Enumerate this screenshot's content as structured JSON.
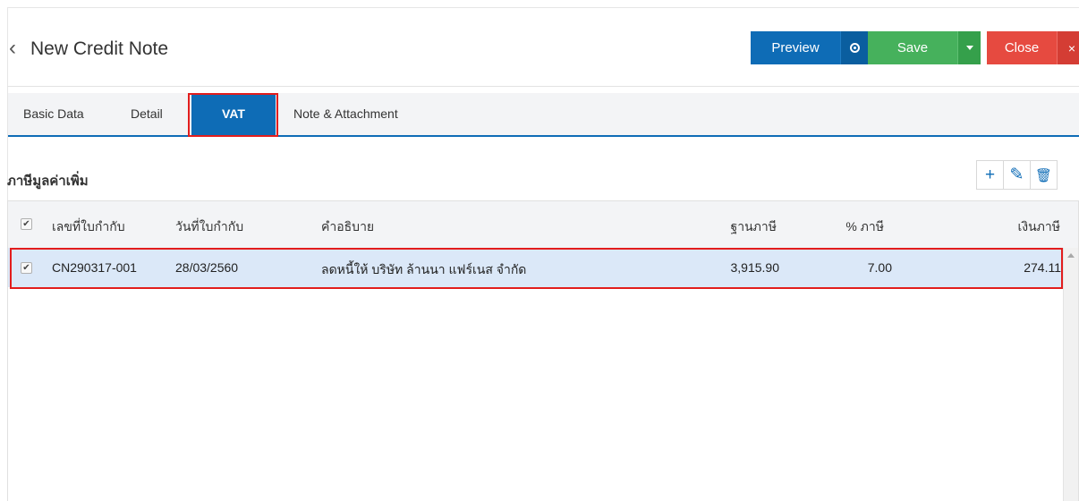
{
  "header": {
    "title": "New Credit Note",
    "back_icon": "chevron-left-icon",
    "preview_label": "Preview",
    "save_label": "Save",
    "close_label": "Close",
    "close_icon_glyph": "×"
  },
  "tabs": [
    {
      "label": "Basic Data"
    },
    {
      "label": "Detail"
    },
    {
      "label": "VAT",
      "active": true
    },
    {
      "label": "Note & Attachment"
    }
  ],
  "section": {
    "title": "ภาษีมูลค่าเพิ่ม",
    "toolbar": {
      "add_glyph": "+",
      "edit_glyph": "✎",
      "delete_glyph": "🗑"
    }
  },
  "table": {
    "columns": {
      "doc_no": "เลขที่ใบกำกับ",
      "doc_date": "วันที่ใบกำกับ",
      "description": "คำอธิบาย",
      "tax_base": "ฐานภาษี",
      "tax_rate": "% ภาษี",
      "tax_amount": "เงินภาษี"
    },
    "rows": [
      {
        "checked": true,
        "doc_no": "CN290317-001",
        "doc_date": "28/03/2560",
        "description": "ลดหนี้ให้ บริษัท ล้านนา แฟร์เนส จำกัด",
        "tax_base": "3,915.90",
        "tax_rate": "7.00",
        "tax_amount": "274.11"
      }
    ]
  },
  "colors": {
    "primary": "#0e6cb6",
    "save": "#46b15c",
    "close": "#e64a40",
    "highlight": "#e21d1d",
    "selected_row": "#dbe8f8"
  }
}
